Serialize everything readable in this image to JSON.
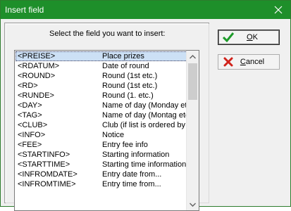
{
  "window": {
    "title": "Insert field"
  },
  "dialog": {
    "prompt": "Select the field you want to insert:",
    "fields": [
      {
        "code": "<PREISE>",
        "description": "Place prizes",
        "selected": true
      },
      {
        "code": "<RDATUM>",
        "description": "Date of round"
      },
      {
        "code": "<ROUND>",
        "description": "Round (1st etc.)"
      },
      {
        "code": "<RD>",
        "description": "Round (1st etc.)"
      },
      {
        "code": "<RUNDE>",
        "description": "Round (1. etc.)"
      },
      {
        "code": "<DAY>",
        "description": "Name of day (Monday etc"
      },
      {
        "code": "<TAG>",
        "description": "Name of day (Montag etc"
      },
      {
        "code": "<CLUB>",
        "description": "Club (if list is ordered by c"
      },
      {
        "code": "<INFO>",
        "description": "Notice"
      },
      {
        "code": "<FEE>",
        "description": "Entry fee info"
      },
      {
        "code": "<STARTINFO>",
        "description": "Starting information"
      },
      {
        "code": "<STARTTIME>",
        "description": "Starting time information"
      },
      {
        "code": "<INFROMDATE>",
        "description": "Entry date from..."
      },
      {
        "code": "<INFROMTIME>",
        "description": "Entry time from..."
      }
    ]
  },
  "buttons": {
    "ok": {
      "label": "OK",
      "icon": "checkmark-icon",
      "color": "#1d9b2a"
    },
    "cancel": {
      "label": "Cancel",
      "icon": "cross-icon",
      "color": "#d0221b"
    }
  }
}
